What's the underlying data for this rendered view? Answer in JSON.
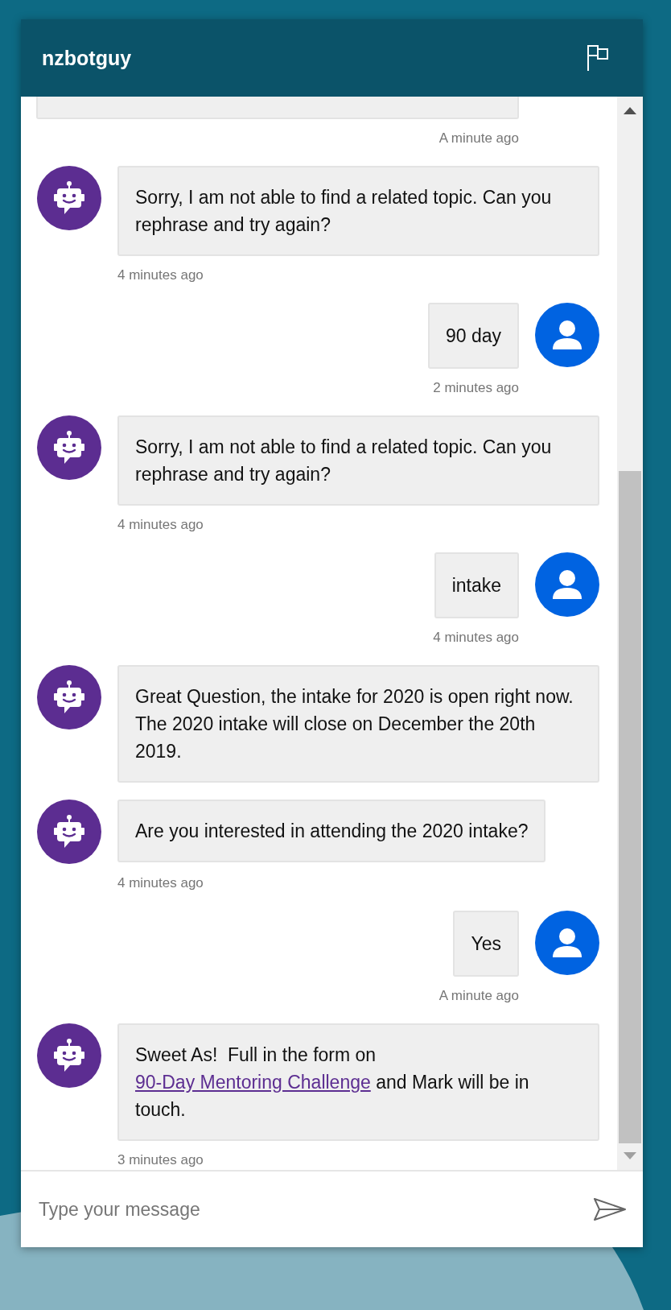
{
  "header": {
    "title": "nzbotguy"
  },
  "messages": [
    {
      "kind": "cut",
      "timestamp": "A minute ago"
    },
    {
      "kind": "bot",
      "parts": [
        {
          "kind": "text",
          "text": "Sorry, I am not able to find a related topic. Can you rephrase and try again?"
        }
      ],
      "timestamp": "4 minutes ago"
    },
    {
      "kind": "user",
      "parts": [
        {
          "kind": "text",
          "text": "90 day"
        }
      ],
      "timestamp": "2 minutes ago"
    },
    {
      "kind": "bot",
      "parts": [
        {
          "kind": "text",
          "text": "Sorry, I am not able to find a related topic. Can you rephrase and try again?"
        }
      ],
      "timestamp": "4 minutes ago"
    },
    {
      "kind": "user",
      "parts": [
        {
          "kind": "text",
          "text": "intake"
        }
      ],
      "timestamp": "4 minutes ago"
    },
    {
      "kind": "bot",
      "parts": [
        {
          "kind": "text",
          "text": "Great Question, the intake for 2020 is open right now.  The 2020 intake will close on December the 20th 2019."
        }
      ]
    },
    {
      "kind": "bot",
      "parts": [
        {
          "kind": "text",
          "text": "Are you interested in attending the 2020 intake?"
        }
      ],
      "timestamp": "4 minutes ago"
    },
    {
      "kind": "user",
      "parts": [
        {
          "kind": "text",
          "text": "Yes"
        }
      ],
      "timestamp": "A minute ago"
    },
    {
      "kind": "bot",
      "parts": [
        {
          "kind": "text",
          "text": "Sweet As!  Full in the form on "
        },
        {
          "kind": "link",
          "text": "90-Day Mentoring Challenge"
        },
        {
          "kind": "text",
          "text": " and Mark will be in touch."
        }
      ],
      "timestamp": "3 minutes ago"
    }
  ],
  "composer": {
    "placeholder": "Type your message"
  }
}
